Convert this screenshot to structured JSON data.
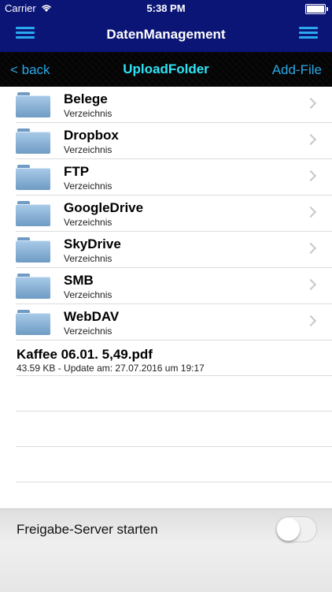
{
  "status_bar": {
    "carrier": "Carrier",
    "time": "5:38 PM"
  },
  "nav": {
    "title": "DatenManagement",
    "left_icon": "menu-icon",
    "right_icon": "menu-icon"
  },
  "toolbar": {
    "back_label": "< back",
    "title": "UploadFolder",
    "add_label": "Add-File"
  },
  "folders": [
    {
      "name": "Belege",
      "type": "Verzeichnis"
    },
    {
      "name": "Dropbox",
      "type": "Verzeichnis"
    },
    {
      "name": "FTP",
      "type": "Verzeichnis"
    },
    {
      "name": "GoogleDrive",
      "type": "Verzeichnis"
    },
    {
      "name": "SkyDrive",
      "type": "Verzeichnis"
    },
    {
      "name": "SMB",
      "type": "Verzeichnis"
    },
    {
      "name": "WebDAV",
      "type": "Verzeichnis"
    }
  ],
  "files": [
    {
      "name": "Kaffee 06.01. 5,49.pdf",
      "info": "43.59 KB - Update am: 27.07.2016 um 19:17"
    }
  ],
  "server": {
    "label": "Freigabe-Server starten",
    "enabled": false
  },
  "colors": {
    "nav_bg": "#0b1576",
    "accent": "#29a9ef",
    "toolbar_title": "#2ee3f6"
  }
}
